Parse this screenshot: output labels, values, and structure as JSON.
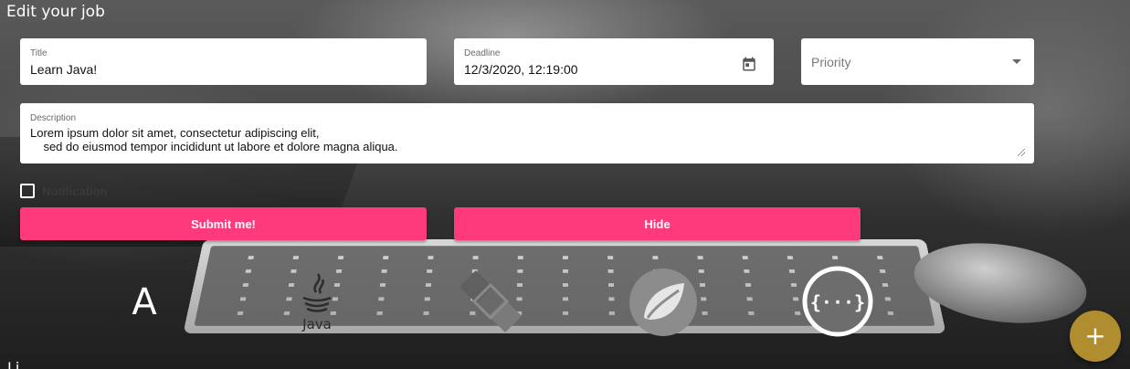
{
  "page": {
    "title": "Edit your job",
    "bottom_text": "Li"
  },
  "form": {
    "title": {
      "label": "Title",
      "value": "Learn Java!"
    },
    "deadline": {
      "label": "Deadline",
      "value": "12/3/2020, 12:19:00",
      "icon": "calendar-icon"
    },
    "priority": {
      "placeholder": "Priority",
      "icon": "dropdown-arrow-icon"
    },
    "description": {
      "label": "Description",
      "value": "Lorem ipsum dolor sit amet, consectetur adipiscing elit,\n    sed do eiusmod tempor incididunt ut labore et dolore magna aliqua."
    },
    "notification": {
      "label": "Notification",
      "checked": false
    },
    "submit_label": "Submit me!",
    "hide_label": "Hide"
  },
  "logos": [
    {
      "name": "angular-logo",
      "text": "A"
    },
    {
      "name": "java-logo",
      "text": "Java"
    },
    {
      "name": "codepen-logo"
    },
    {
      "name": "spring-logo"
    },
    {
      "name": "swagger-logo",
      "text": "{···}"
    }
  ],
  "fab": {
    "label": "+",
    "icon": "plus-icon"
  },
  "colors": {
    "accent_pink": "#ff3a7c",
    "fab_gold": "#b08d2e",
    "field_bg": "#ffffff"
  }
}
